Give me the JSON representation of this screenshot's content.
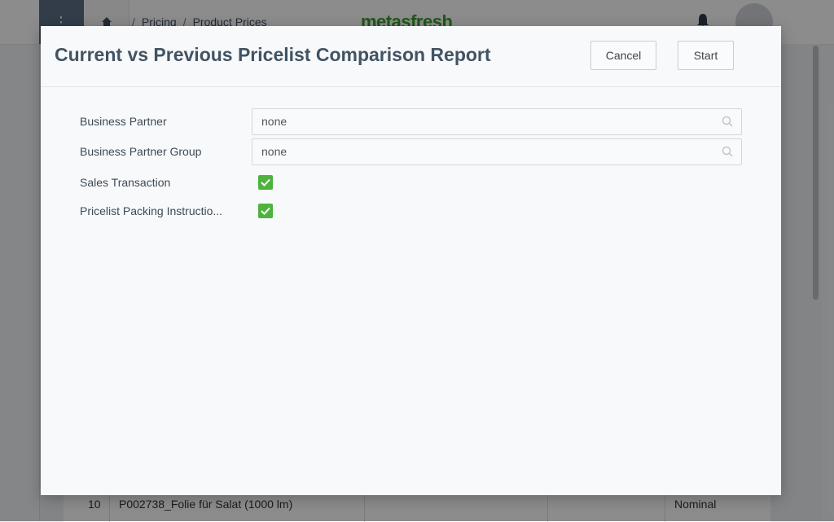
{
  "background": {
    "breadcrumb": [
      "Pricing",
      "Product Prices"
    ],
    "breadcrumb_sep": "/",
    "logo": "metasfresh",
    "table_row": {
      "line_no": "10",
      "product": "P002738_Folie für Salat (1000 lm)",
      "type": "Nominal"
    }
  },
  "dialog": {
    "title": "Current vs Previous Pricelist Comparison Report",
    "cancel_label": "Cancel",
    "start_label": "Start",
    "fields": [
      {
        "label": "Business Partner",
        "value": "none"
      },
      {
        "label": "Business Partner Group",
        "value": "none"
      },
      {
        "label": "Sales Transaction",
        "checked": true
      },
      {
        "label": "Pricelist Packing Instructio...",
        "checked": true
      }
    ]
  },
  "colors": {
    "accent_green": "#4db33d",
    "menu_blue": "#5b6f86",
    "title_text": "#425362"
  },
  "icons": {
    "lookup": "search-icon",
    "checkbox": "check-icon",
    "home": "home-icon",
    "bell": "bell-icon"
  }
}
